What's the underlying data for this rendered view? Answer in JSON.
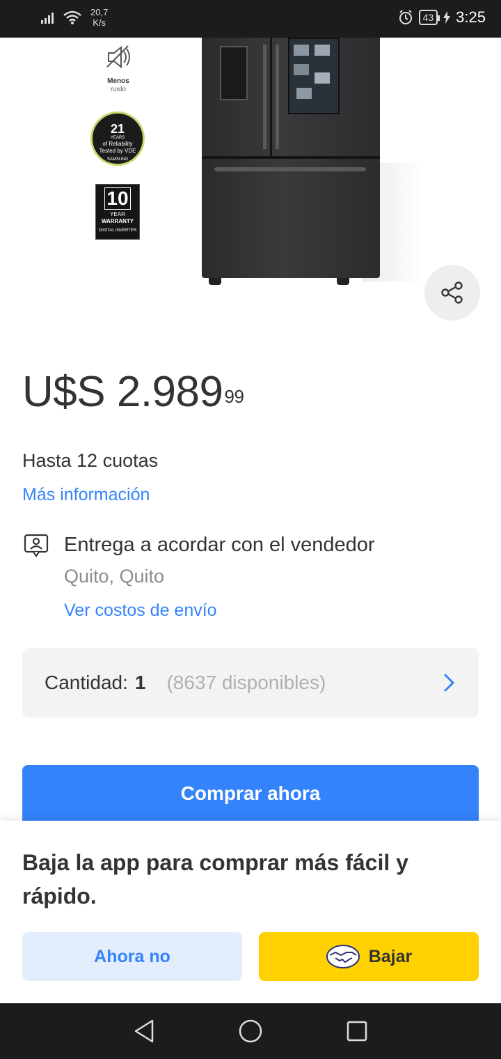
{
  "status_bar": {
    "speed_value": "20,7",
    "speed_unit": "K/s",
    "battery": "43",
    "time": "3:25"
  },
  "product_image": {
    "feature_noise_line1": "Menos",
    "feature_noise_line2": "ruido",
    "badge_21_number": "21",
    "badge_21_years": "YEARS",
    "badge_21_line1": "of Reliability",
    "badge_21_line2": "Tested by VDE",
    "badge_21_brand": "SAMSUNG",
    "badge_10_number": "10",
    "badge_10_line1": "YEAR",
    "badge_10_line2": "WARRANTY",
    "badge_10_line3": "DIGITAL INVERTER"
  },
  "price": {
    "currency": "U$S",
    "integer": "2.989",
    "cents": "99"
  },
  "installments": {
    "text": "Hasta 12 cuotas",
    "more_info": "Más información"
  },
  "delivery": {
    "title": "Entrega a acordar con el vendedor",
    "location": "Quito, Quito",
    "shipping_link": "Ver costos de envío"
  },
  "quantity": {
    "label": "Cantidad:",
    "value": "1",
    "available": "(8637 disponibles)"
  },
  "buy_button": "Comprar ahora",
  "app_banner": {
    "text": "Baja la app para comprar más fácil y rápido.",
    "dismiss": "Ahora no",
    "download": "Bajar"
  },
  "colors": {
    "accent": "#3483fa",
    "yellow": "#ffd100"
  }
}
